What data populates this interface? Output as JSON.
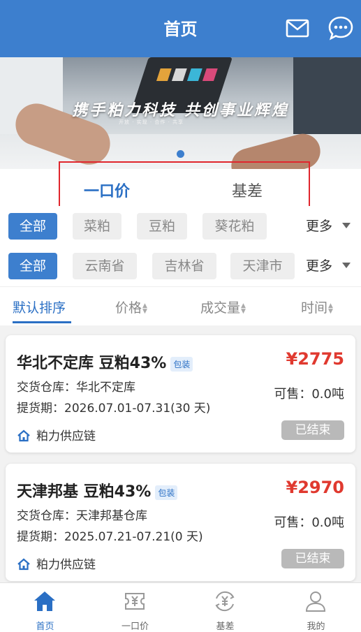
{
  "header": {
    "title": "首页",
    "mail_icon": "mail-icon",
    "chat_icon": "chat-icon",
    "color": "#3d7fce"
  },
  "banner": {
    "slogan": "携手粕力科技  共创事业辉煌",
    "subtitle": "开放 · 实现 · 合作 · 共享"
  },
  "tabs": [
    {
      "label": "一口价",
      "active": true
    },
    {
      "label": "基差",
      "active": false
    }
  ],
  "filters": {
    "products": {
      "items": [
        "全部",
        "菜粕",
        "豆粕",
        "葵花粕"
      ],
      "selected": 0,
      "more": "更多"
    },
    "regions": {
      "items": [
        "全部",
        "云南省",
        "吉林省",
        "天津市"
      ],
      "selected": 0,
      "more": "更多"
    }
  },
  "sort": {
    "items": [
      "默认排序",
      "价格",
      "成交量",
      "时间"
    ],
    "active": 0
  },
  "cards": [
    {
      "title": "华北不定库   豆粕43%",
      "tag": "包装",
      "price": "¥2775",
      "warehouse": "交货仓库：华北不定库",
      "pickup": "提货期：2026.07.01-07.31(30 天)",
      "available": "可售：0.0吨",
      "supplier": "粕力供应链",
      "status": "已结束"
    },
    {
      "title": "天津邦基 豆粕43%",
      "tag": "包装",
      "price": "¥2970",
      "warehouse": "交货仓库：天津邦基仓库",
      "pickup": "提货期：2025.07.21-07.21(0 天)",
      "available": "可售：0.0吨",
      "supplier": "粕力供应链",
      "status": "已结束"
    }
  ],
  "bottom_nav": [
    {
      "label": "首页",
      "icon": "home-icon",
      "active": true
    },
    {
      "label": "一口价",
      "icon": "yuan-ticket-icon",
      "active": false
    },
    {
      "label": "基差",
      "icon": "yuan-exchange-icon",
      "active": false
    },
    {
      "label": "我的",
      "icon": "user-icon",
      "active": false
    }
  ],
  "colors": {
    "accent": "#3d7fce",
    "price": "#e0392f",
    "highlight_box": "#e0262d"
  }
}
